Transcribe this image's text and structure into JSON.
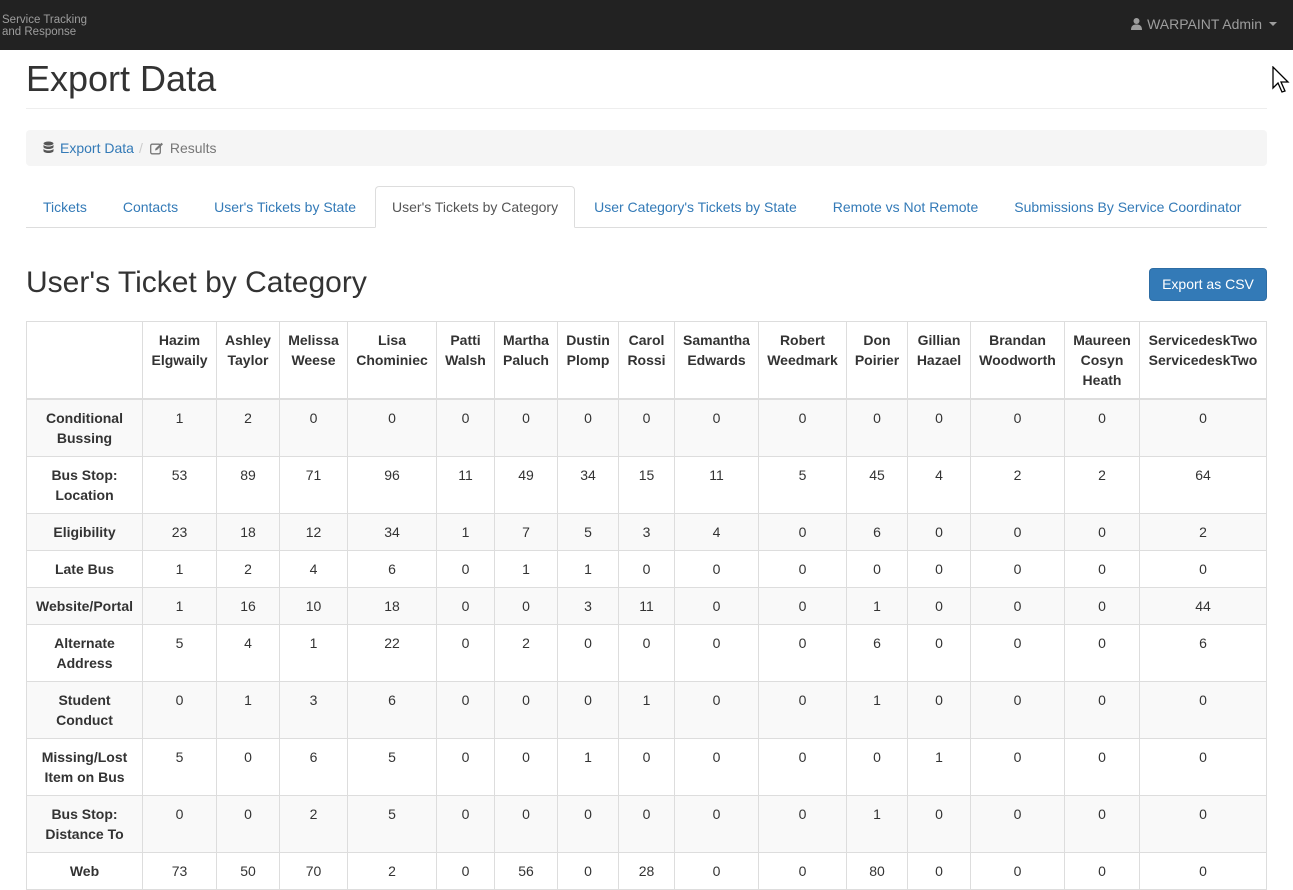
{
  "navbar": {
    "brand_line1": "Service Tracking",
    "brand_line2": "and Response",
    "user_label": "WARPAINT Admin",
    "user_icon": "user-icon"
  },
  "page": {
    "title": "Export Data"
  },
  "breadcrumb": {
    "items": [
      {
        "label": "Export Data",
        "icon": "database-icon"
      },
      {
        "label": "Results",
        "icon": "edit-icon"
      }
    ],
    "separator": "/"
  },
  "tabs": [
    {
      "label": "Tickets",
      "active": false
    },
    {
      "label": "Contacts",
      "active": false
    },
    {
      "label": "User's Tickets by State",
      "active": false
    },
    {
      "label": "User's Tickets by Category",
      "active": true
    },
    {
      "label": "User Category's Tickets by State",
      "active": false
    },
    {
      "label": "Remote vs Not Remote",
      "active": false
    },
    {
      "label": "Submissions By Service Coordinator",
      "active": false
    }
  ],
  "section": {
    "title": "User's Ticket by Category",
    "export_label": "Export as CSV"
  },
  "table": {
    "columns": [
      "Hazim Elgwaily",
      "Ashley Taylor",
      "Melissa Weese",
      "Lisa Chominiec",
      "Patti Walsh",
      "Martha Paluch",
      "Dustin Plomp",
      "Carol Rossi",
      "Samantha Edwards",
      "Robert Weedmark",
      "Don Poirier",
      "Gillian Hazael",
      "Brandan Woodworth",
      "Maureen Cosyn Heath",
      "ServicedeskTwo ServicedeskTwo"
    ],
    "rows": [
      {
        "label": "Conditional Bussing",
        "values": [
          "1",
          "2",
          "0",
          "0",
          "0",
          "0",
          "0",
          "0",
          "0",
          "0",
          "0",
          "0",
          "0",
          "0",
          "0"
        ]
      },
      {
        "label": "Bus Stop: Location",
        "values": [
          "53",
          "89",
          "71",
          "96",
          "11",
          "49",
          "34",
          "15",
          "11",
          "5",
          "45",
          "4",
          "2",
          "2",
          "64"
        ]
      },
      {
        "label": "Eligibility",
        "values": [
          "23",
          "18",
          "12",
          "34",
          "1",
          "7",
          "5",
          "3",
          "4",
          "0",
          "6",
          "0",
          "0",
          "0",
          "2"
        ]
      },
      {
        "label": "Late Bus",
        "values": [
          "1",
          "2",
          "4",
          "6",
          "0",
          "1",
          "1",
          "0",
          "0",
          "0",
          "0",
          "0",
          "0",
          "0",
          "0"
        ]
      },
      {
        "label": "Website/Portal",
        "values": [
          "1",
          "16",
          "10",
          "18",
          "0",
          "0",
          "3",
          "11",
          "0",
          "0",
          "1",
          "0",
          "0",
          "0",
          "44"
        ]
      },
      {
        "label": "Alternate Address",
        "values": [
          "5",
          "4",
          "1",
          "22",
          "0",
          "2",
          "0",
          "0",
          "0",
          "0",
          "6",
          "0",
          "0",
          "0",
          "6"
        ]
      },
      {
        "label": "Student Conduct",
        "values": [
          "0",
          "1",
          "3",
          "6",
          "0",
          "0",
          "0",
          "1",
          "0",
          "0",
          "1",
          "0",
          "0",
          "0",
          "0"
        ]
      },
      {
        "label": "Missing/Lost Item on Bus",
        "values": [
          "5",
          "0",
          "6",
          "5",
          "0",
          "0",
          "1",
          "0",
          "0",
          "0",
          "0",
          "1",
          "0",
          "0",
          "0"
        ]
      },
      {
        "label": "Bus Stop: Distance To",
        "values": [
          "0",
          "0",
          "2",
          "5",
          "0",
          "0",
          "0",
          "0",
          "0",
          "0",
          "1",
          "0",
          "0",
          "0",
          "0"
        ]
      },
      {
        "label": "Web",
        "values": [
          "73",
          "50",
          "70",
          "2",
          "0",
          "56",
          "0",
          "28",
          "0",
          "0",
          "80",
          "0",
          "0",
          "0",
          "0"
        ]
      }
    ]
  },
  "colors": {
    "navbar_bg": "#222222",
    "link": "#337ab7",
    "primary_button": "#337ab7",
    "border": "#dddddd"
  }
}
